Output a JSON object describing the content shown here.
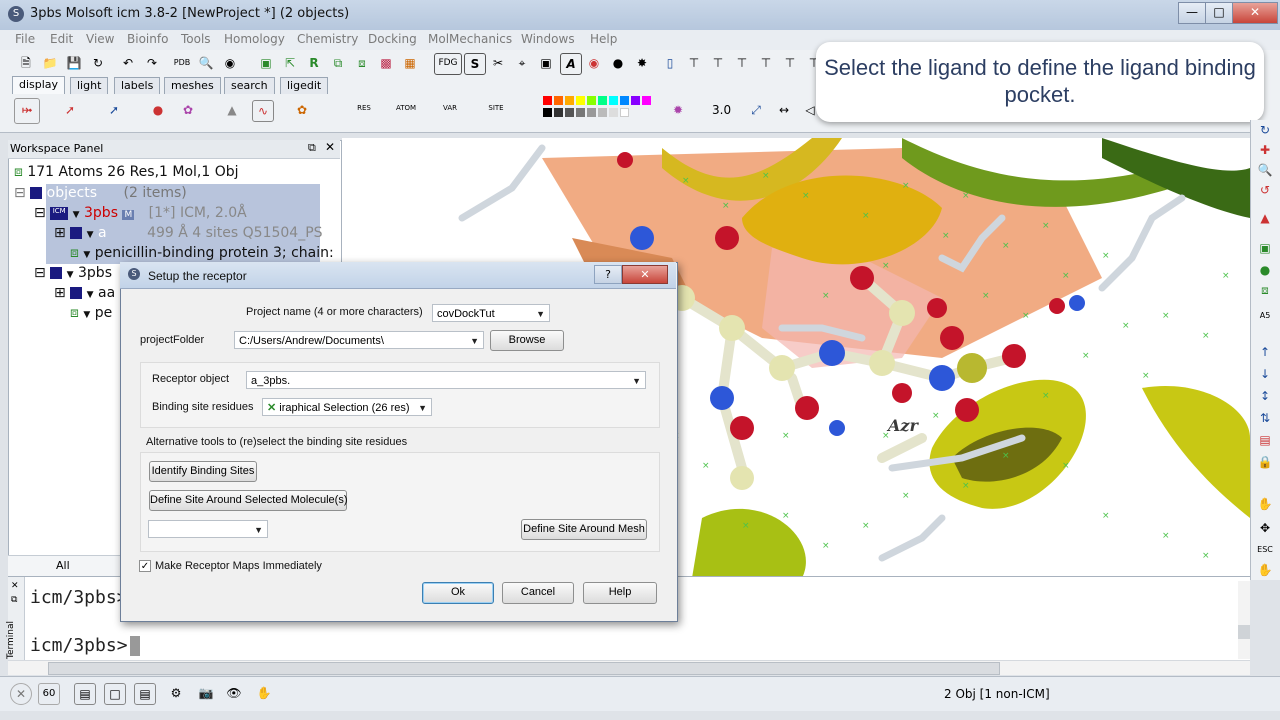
{
  "window": {
    "title": "3pbs Molsoft icm 3.8-2  [NewProject *] (2 objects)"
  },
  "menu": [
    "File",
    "Edit",
    "View",
    "Bioinfo",
    "Tools",
    "Homology",
    "Chemistry",
    "Docking",
    "MolMechanics",
    "Windows",
    "Help"
  ],
  "tabs": [
    "display",
    "light",
    "labels",
    "meshes",
    "search",
    "ligedit"
  ],
  "toolbar": {
    "fdg_label": "FDG",
    "zoom_value": "3.0"
  },
  "tooltip": {
    "text": "Select the ligand to define the ligand binding pocket."
  },
  "workspace": {
    "title": "Workspace Panel",
    "summary": "171 Atoms 26 Res,1 Mol,1 Obj",
    "objects_label": "objects",
    "objects_count": "(2 items)",
    "obj1_name": "3pbs",
    "obj1_info": "[1*] ICM, 2.0Å",
    "row_a_info": "499 Å  4 sites Q51504_PS",
    "row_protein": "penicillin-binding protein 3; chain:",
    "obj2_name": "3pbs",
    "row_aa": "aa",
    "row_pe": "pe",
    "filter_label": "All"
  },
  "view": {
    "label": "Azr"
  },
  "dialog": {
    "title": "Setup the receptor",
    "project_name_label": "Project name (4 or more characters)",
    "project_name_value": "covDockTut",
    "folder_label": "projectFolder",
    "folder_value": "C:/Users/Andrew/Documents\\",
    "browse_label": "Browse",
    "receptor_label": "Receptor object",
    "receptor_value": "a_3pbs.",
    "binding_label": "Binding site residues",
    "binding_value": "iraphical Selection (26 res)",
    "alt_tools_label": "Alternative tools to (re)select the binding site residues",
    "identify_label": "Identify Binding Sites",
    "define_selected_label": "Define Site Around Selected Molecule(s)",
    "define_mesh_label": "Define Site Around Mesh",
    "maps_label": "Make Receptor Maps Immediately",
    "maps_checked": true,
    "ok_label": "Ok",
    "cancel_label": "Cancel",
    "help_label": "Help"
  },
  "terminal": {
    "line1": "icm/3pbs>",
    "prompt": "icm/3pbs>",
    "side_label": "Terminal"
  },
  "status": {
    "text": "2 Obj [1 non-ICM]",
    "count_60": "60"
  },
  "colors": {
    "accent": "#3c7fb1",
    "title_bg": "#c2d3e8",
    "tooltip_text": "#2c3e62"
  }
}
